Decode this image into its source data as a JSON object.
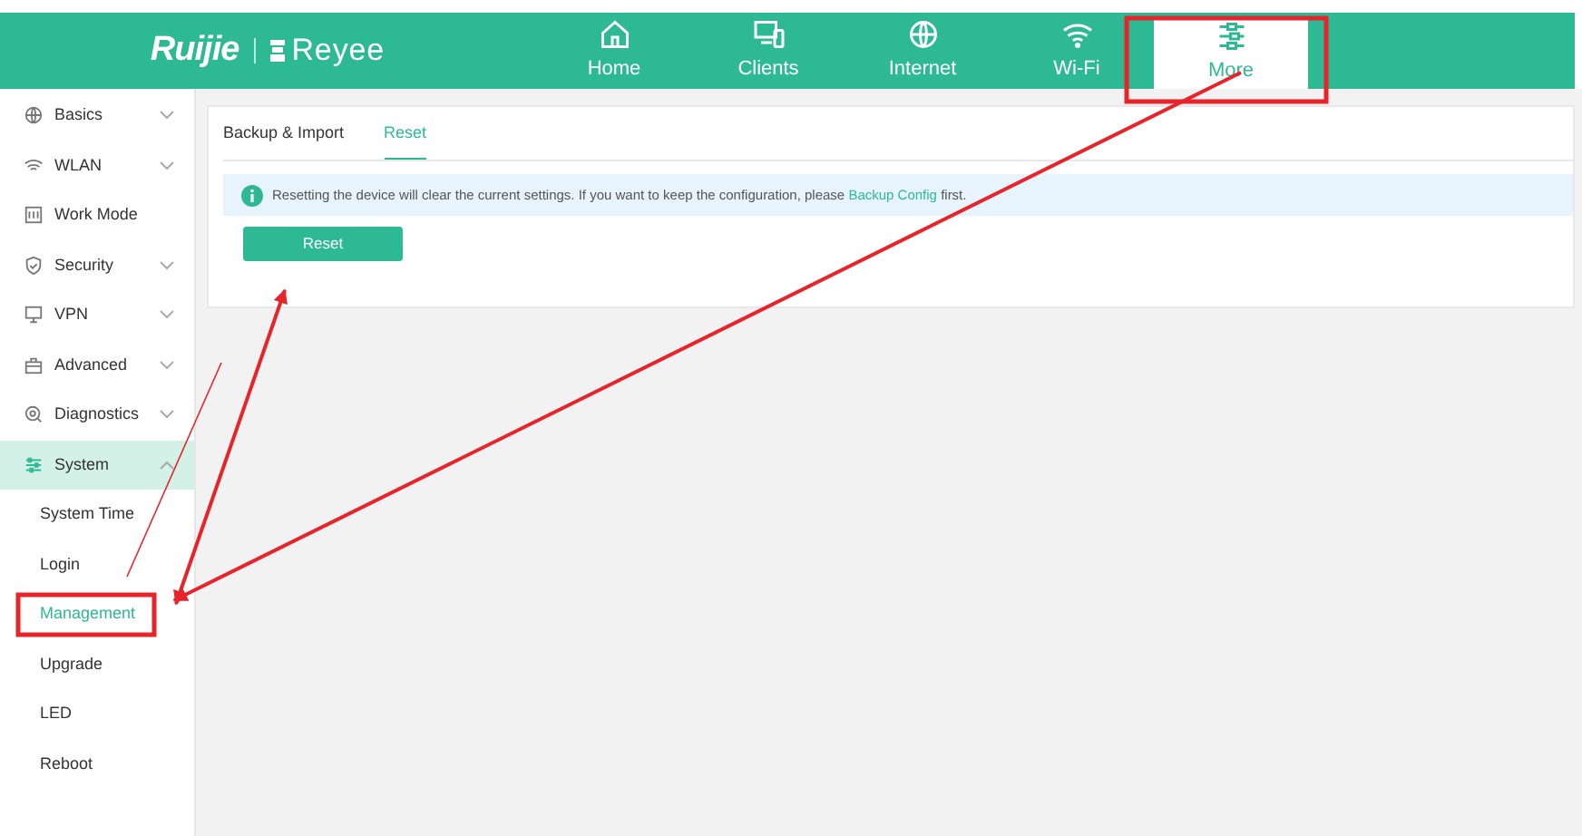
{
  "brand": {
    "name": "Ruijie",
    "product": "Reyee"
  },
  "nav": [
    {
      "label": "Home",
      "selected": false
    },
    {
      "label": "Clients",
      "selected": false
    },
    {
      "label": "Internet",
      "selected": false
    },
    {
      "label": "Wi-Fi",
      "selected": false
    },
    {
      "label": "More",
      "selected": true
    }
  ],
  "sidebar": {
    "items": [
      {
        "label": "Basics",
        "kind": "group",
        "expanded": false,
        "selected": false
      },
      {
        "label": "WLAN",
        "kind": "group",
        "expanded": false,
        "selected": false
      },
      {
        "label": "Work Mode",
        "kind": "link",
        "selected": false
      },
      {
        "label": "Security",
        "kind": "group",
        "expanded": false,
        "selected": false
      },
      {
        "label": "VPN",
        "kind": "group",
        "expanded": false,
        "selected": false
      },
      {
        "label": "Advanced",
        "kind": "group",
        "expanded": false,
        "selected": false
      },
      {
        "label": "Diagnostics",
        "kind": "group",
        "expanded": false,
        "selected": false
      },
      {
        "label": "System",
        "kind": "group",
        "expanded": true,
        "selected": true,
        "children": [
          {
            "label": "System Time",
            "selected": false
          },
          {
            "label": "Login",
            "selected": false
          },
          {
            "label": "Management",
            "selected": true
          },
          {
            "label": "Upgrade",
            "selected": false
          },
          {
            "label": "LED",
            "selected": false
          },
          {
            "label": "Reboot",
            "selected": false
          }
        ]
      }
    ]
  },
  "tabs": [
    {
      "label": "Backup & Import",
      "selected": false
    },
    {
      "label": "Reset",
      "selected": true
    }
  ],
  "notice": {
    "before": "Resetting the device will clear the current settings. If you want to keep the configuration, please",
    "link": "Backup Config",
    "after": "first."
  },
  "reset_button": "Reset"
}
